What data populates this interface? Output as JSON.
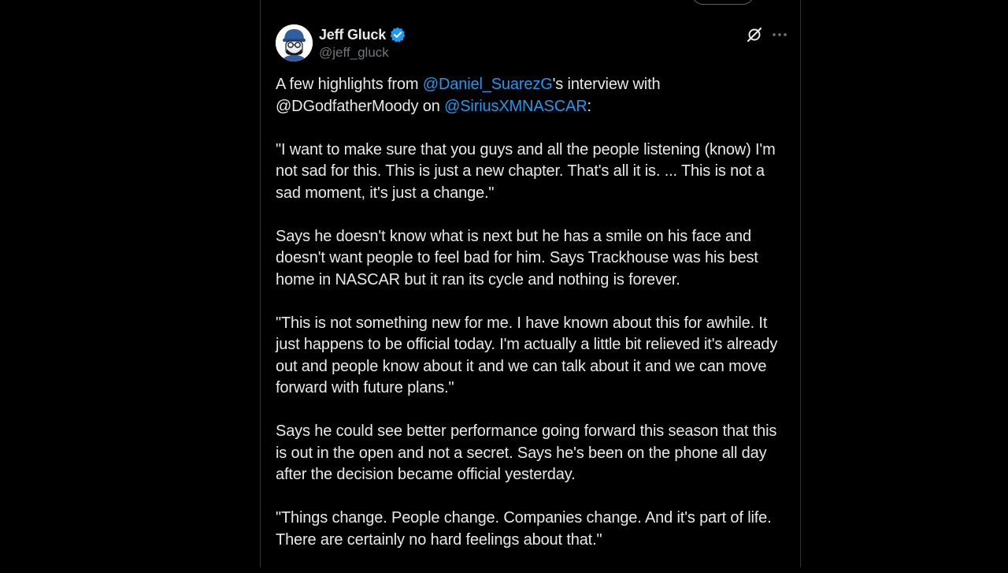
{
  "tweet": {
    "author": {
      "display_name": "Jeff Gluck",
      "handle": "@jeff_gluck",
      "verified": true,
      "avatar_icon": "cartoon-avatar-icon"
    },
    "actions": {
      "grok_icon": "grok-icon",
      "more_icon": "more-icon"
    },
    "intro": {
      "part1": "A few highlights from ",
      "mention1": "@Daniel_SuarezG",
      "part2": "'s interview with @DGodfatherMoody on ",
      "mention2": "@SiriusXMNASCAR",
      "part3": ":"
    },
    "paragraphs": [
      "\"I want to make sure that you guys and all the people listening (know) I'm not sad for this. This is just a new chapter. That's all it is. ... This is not a sad moment, it's just a change.\"",
      "Says he doesn't know what is next but he has a smile on his face and doesn't want people to feel bad for him. Says Trackhouse was his best home in NASCAR but it ran its cycle and nothing is forever.",
      "\"This is not something new for me. I have known about this for awhile. It just happens to be official today. I'm actually a little bit relieved it's already out and people know about it and we can talk about it and we can move forward with future plans.\"",
      "Says he could see better performance going forward this season that this is out in the open and not a secret. Says he's been on the phone all day after the decision became official yesterday.",
      "\"Things change. People change. Companies change. And it's part of life. There are certainly no hard feelings about that.\""
    ]
  },
  "colors": {
    "background": "#000000",
    "text": "#e7e9ea",
    "secondary_text": "#71767b",
    "link": "#1d9bf0",
    "border": "#2f3336",
    "verified_badge": "#1d9bf0"
  }
}
